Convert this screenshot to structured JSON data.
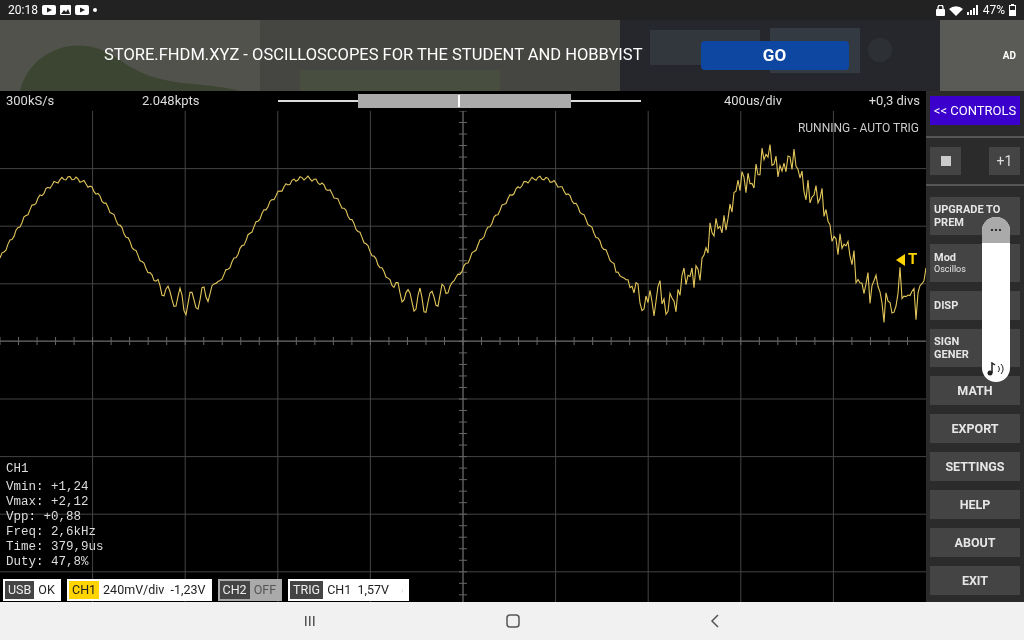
{
  "status_bar": {
    "time": "20:18",
    "battery": "47%"
  },
  "ad": {
    "text": "STORE.FHDM.XYZ - OSCILLOSCOPES FOR THE STUDENT AND HOBBYIST",
    "button": "GO",
    "badge": "AD"
  },
  "info_bar": {
    "sample_rate": "300kS/s",
    "points": "2.048kpts",
    "timebase": "400us/div",
    "offset": "+0,3 divs"
  },
  "scope": {
    "status": "RUNNING - AUTO TRIG",
    "trigger_marker": "T",
    "measurements": {
      "title": "CH1",
      "lines": [
        "Vmin: +1,24",
        "Vmax: +2,12",
        "Vpp: +0,88",
        "Freq: 2,6kHz",
        "Time: 379,9us",
        "Duty: 47,8%"
      ]
    }
  },
  "channel_bar": [
    {
      "kind": "usb",
      "label": "USB",
      "value": "OK",
      "enabled": true
    },
    {
      "kind": "channel",
      "label": "CH1",
      "value": "240mV/div  -1,23V",
      "enabled": true,
      "color": "#ffd400"
    },
    {
      "kind": "channel",
      "label": "CH2",
      "value": "OFF",
      "enabled": false
    },
    {
      "kind": "trigger",
      "label": "TRIG",
      "value": "CH1  1,57V",
      "enabled": true
    }
  ],
  "controls": {
    "toggle": "<< CONTROLS",
    "step": "+1",
    "menu": [
      {
        "lines": [
          "UPGRADE TO",
          "PREM"
        ],
        "covered": true
      },
      {
        "lines": [
          "Mod"
        ],
        "sub": "Oscillos",
        "covered": true
      },
      {
        "lines": [
          "DISP"
        ],
        "covered": true
      },
      {
        "lines": [
          "SIGN",
          "GENER"
        ],
        "covered": true
      },
      {
        "lines": [
          "MATH"
        ],
        "covered": false
      },
      {
        "lines": [
          "EXPORT"
        ],
        "covered": false
      },
      {
        "lines": [
          "SETTINGS"
        ],
        "covered": false
      },
      {
        "lines": [
          "HELP"
        ],
        "covered": false
      },
      {
        "lines": [
          "ABOUT"
        ],
        "covered": false
      },
      {
        "lines": [
          "EXIT"
        ],
        "covered": false
      }
    ],
    "overlay": {
      "handle": "..."
    }
  }
}
